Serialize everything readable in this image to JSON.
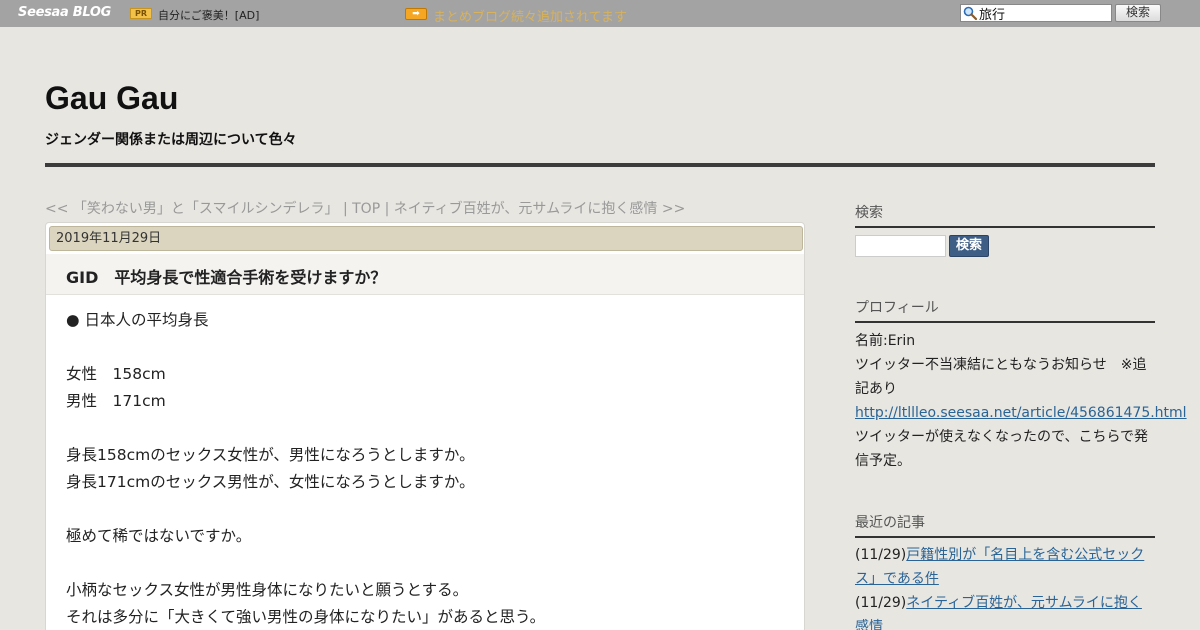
{
  "topbar": {
    "logo": "Seesaa BLOG",
    "pr_badge": "PR",
    "pr_link": "自分にご褒美！[AD]",
    "notice_icon": "➡",
    "notice_link": "まとめブログ続々追加されてます",
    "search_value": "旅行",
    "search_button": "検索"
  },
  "header": {
    "title": "Gau Gau",
    "description": "ジェンダー関係または周辺について色々"
  },
  "article_nav": {
    "prev": "<< 「笑わない男」と「スマイルシンデレラ」",
    "sep1": " | ",
    "top": "TOP",
    "sep2": " | ",
    "next": "ネイティブ百姓が、元サムライに抱く感情 >>"
  },
  "article": {
    "date": "2019年11月29日",
    "title": "GID　平均身長で性適合手術を受けますか？",
    "lines": [
      "● 日本人の平均身長",
      "",
      "女性　158cm",
      "男性　171cm",
      "",
      "身長158cmのセックス女性が、男性になろうとしますか。",
      "身長171cmのセックス男性が、女性になろうとしますか。",
      "",
      "極めて稀ではないですか。",
      "",
      "小柄なセックス女性が男性身体になりたいと願うとする。",
      "それは多分に「大きくて強い男性の身体になりたい」があると思う。"
    ]
  },
  "sidebar": {
    "search_heading": "検索",
    "search_button": "検索",
    "profile_heading": "プロフィール",
    "profile_name": "名前:Erin",
    "profile_text1": "ツイッター不当凍結にともなうお知らせ　※追記あり",
    "profile_link": "http://ltllleo.seesaa.net/article/456861475.html",
    "profile_text2": "ツイッターが使えなくなったので、こちらで発信予定。",
    "recent_heading": "最近の記事",
    "recent": [
      {
        "date": "(11/29)",
        "title": "戸籍性別が「名目上を含む公式セックス」である件"
      },
      {
        "date": "(11/29)",
        "title": "ネイティブ百姓が、元サムライに抱く感情"
      }
    ]
  },
  "colors": {
    "background": "#e8e6e1",
    "topbar": "#a3a3a3",
    "date_bar": "#dbd5c0",
    "link": "#2a6496",
    "search_button": "#3e5e86"
  }
}
